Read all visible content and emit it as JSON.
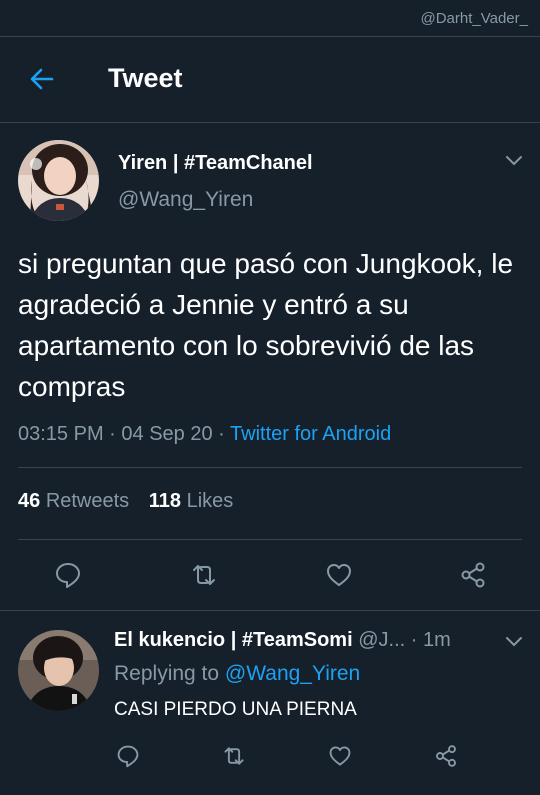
{
  "watermark": "@Darht_Vader_",
  "header": {
    "title": "Tweet"
  },
  "tweet": {
    "author_name": "Yiren | #TeamChanel",
    "author_handle": "@Wang_Yiren",
    "text": "si preguntan que pasó con Jungkook, le agradeció a Jennie y entró a su apartamento con lo sobrevivió de las compras",
    "time": "03:15 PM",
    "date": "04 Sep 20",
    "separator": "·",
    "source": "Twitter for Android",
    "retweets_count": "46",
    "retweets_label": "Retweets",
    "likes_count": "118",
    "likes_label": "Likes"
  },
  "reply": {
    "author_name": "El kukencio | #TeamSomi",
    "author_handle": "@J...",
    "time_sep": "·",
    "time": "1m",
    "replying_label": "Replying to",
    "replying_to": "@Wang_Yiren",
    "text": "CASI PIERDO UNA PIERNA"
  },
  "icons": {
    "back": "back-arrow-icon",
    "caret": "chevron-down-icon",
    "reply": "reply-icon",
    "retweet": "retweet-icon",
    "like": "heart-icon",
    "share": "share-icon"
  },
  "colors": {
    "background": "#15202b",
    "accent": "#1da1f2",
    "secondary_text": "#8899a6",
    "divider": "#38444d"
  }
}
